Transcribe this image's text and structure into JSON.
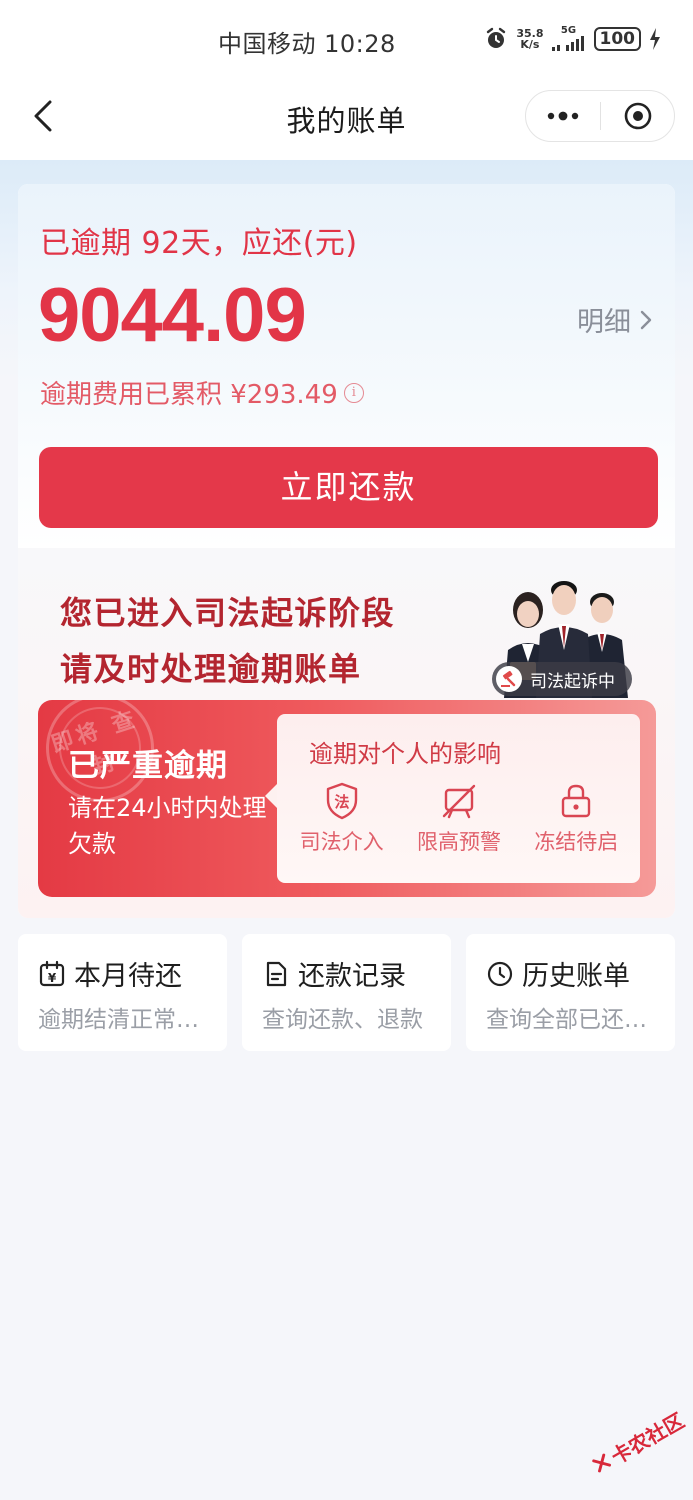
{
  "status_bar": {
    "carrier_time": "中国移动 10:28",
    "net_speed_value": "35.8",
    "net_speed_unit": "K/s",
    "network": "5G",
    "battery": "100"
  },
  "header": {
    "title": "我的账单"
  },
  "bill": {
    "overdue_title": "已逾期 92天，应还(元)",
    "amount": "9044.09",
    "detail_label": "明细",
    "fee_text": "逾期费用已累积 ¥293.49",
    "repay_button": "立即还款"
  },
  "legal": {
    "line1": "您已进入司法起诉阶段",
    "line2": "请及时处理逾期账单",
    "tag": "司法起诉中",
    "stamp_text": "即将 查封",
    "severe_title": "已严重逾期",
    "severe_desc": "请在24小时内处理欠款",
    "impact_title": "逾期对个人的影响",
    "impacts": [
      {
        "label": "司法介入",
        "icon": "law-shield-icon"
      },
      {
        "label": "限高预警",
        "icon": "no-flight-icon"
      },
      {
        "label": "冻结待启",
        "icon": "lock-icon"
      }
    ]
  },
  "quick_links": [
    {
      "title": "本月待还",
      "subtitle": "逾期结清正常还款",
      "icon": "calendar-yen-icon"
    },
    {
      "title": "还款记录",
      "subtitle": "查询还款、退款",
      "icon": "document-icon"
    },
    {
      "title": "历史账单",
      "subtitle": "查询全部已还账单",
      "icon": "clock-icon"
    }
  ],
  "watermark": "卡农社区",
  "colors": {
    "accent_red": "#e4384a",
    "legal_red": "#b3252f",
    "muted_gray": "#9a9ea6"
  }
}
